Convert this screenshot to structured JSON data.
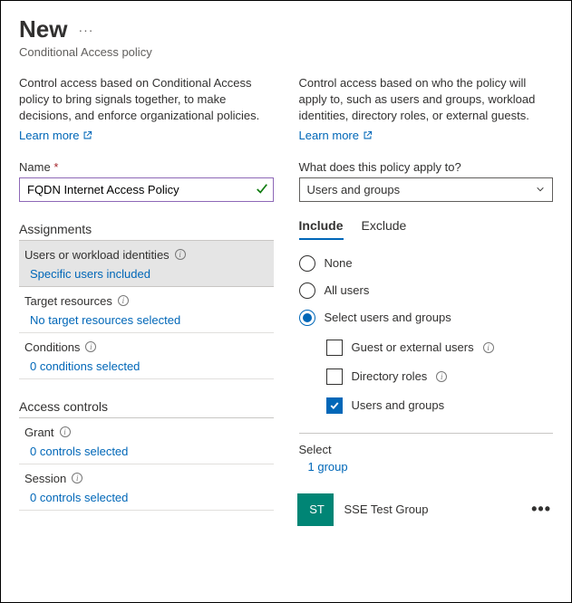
{
  "header": {
    "title": "New",
    "subtitle": "Conditional Access policy"
  },
  "left": {
    "desc": "Control access based on Conditional Access policy to bring signals together, to make decisions, and enforce organizational policies.",
    "learn_more": "Learn more",
    "name_label": "Name",
    "name_value": "FQDN Internet Access Policy",
    "assignments_header": "Assignments",
    "users_row": {
      "title": "Users or workload identities",
      "value": "Specific users included"
    },
    "targets_row": {
      "title": "Target resources",
      "value": "No target resources selected"
    },
    "conditions_row": {
      "title": "Conditions",
      "value": "0 conditions selected"
    },
    "controls_header": "Access controls",
    "grant_row": {
      "title": "Grant",
      "value": "0 controls selected"
    },
    "session_row": {
      "title": "Session",
      "value": "0 controls selected"
    }
  },
  "right": {
    "desc": "Control access based on who the policy will apply to, such as users and groups, workload identities, directory roles, or external guests.",
    "learn_more": "Learn more",
    "apply_label": "What does this policy apply to?",
    "apply_value": "Users and groups",
    "tabs": {
      "include": "Include",
      "exclude": "Exclude"
    },
    "radios": {
      "none": "None",
      "all": "All users",
      "select": "Select users and groups"
    },
    "checks": {
      "guest": "Guest or external users",
      "roles": "Directory roles",
      "usersgroups": "Users and groups"
    },
    "select_label": "Select",
    "select_value": "1 group",
    "group": {
      "initials": "ST",
      "name": "SSE Test Group"
    }
  }
}
